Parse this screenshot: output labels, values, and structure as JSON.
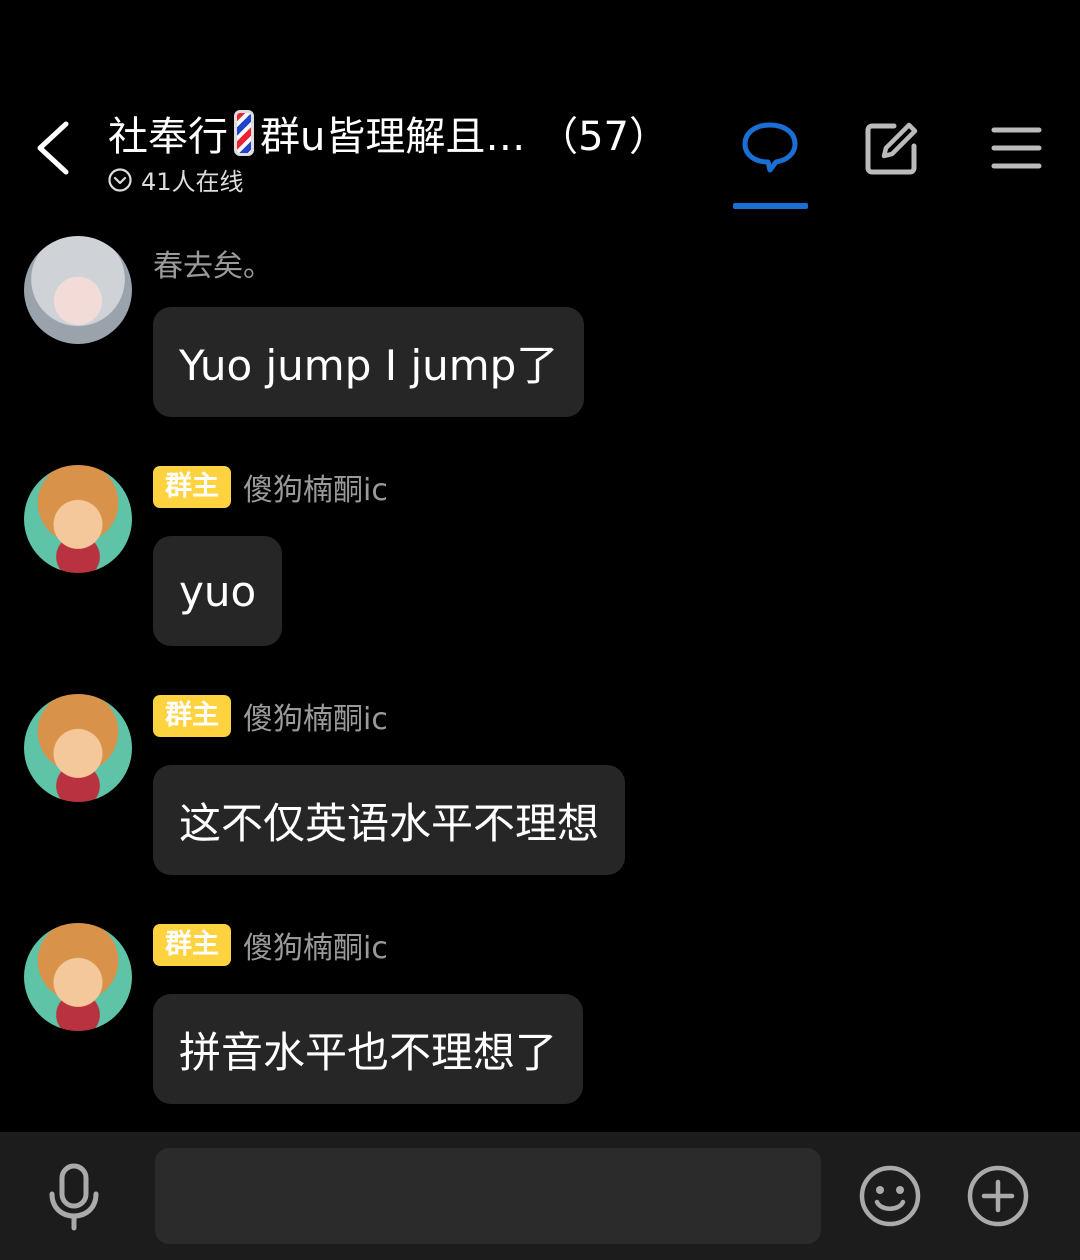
{
  "header": {
    "title_part1": "社奉行",
    "title_part2": "群u皆理解且… （57）",
    "online_text": "41人在线",
    "accent_color": "#1a6fd4",
    "icons": [
      "back-arrow-icon",
      "barber-pole-emoji",
      "chevron-down-circle-icon",
      "chat-bubble-icon",
      "edit-icon",
      "menu-icon"
    ]
  },
  "messages": [
    {
      "sender": "春去矣。",
      "badge": "",
      "text": "Yuo jump I jump了",
      "avatar": "anime-girl-avatar"
    },
    {
      "sender": "傻狗楠酮ic",
      "badge": "群主",
      "text": "yuo",
      "avatar": "anime-boy-avatar"
    },
    {
      "sender": "傻狗楠酮ic",
      "badge": "群主",
      "text": "这不仅英语水平不理想",
      "avatar": "anime-boy-avatar"
    },
    {
      "sender": "傻狗楠酮ic",
      "badge": "群主",
      "text": "拼音水平也不理想了",
      "avatar": "anime-boy-avatar"
    }
  ],
  "input_bar": {
    "placeholder": "",
    "icons": [
      "microphone-icon",
      "emoji-icon",
      "plus-circle-icon"
    ],
    "badge_color": "#ffd23f"
  }
}
